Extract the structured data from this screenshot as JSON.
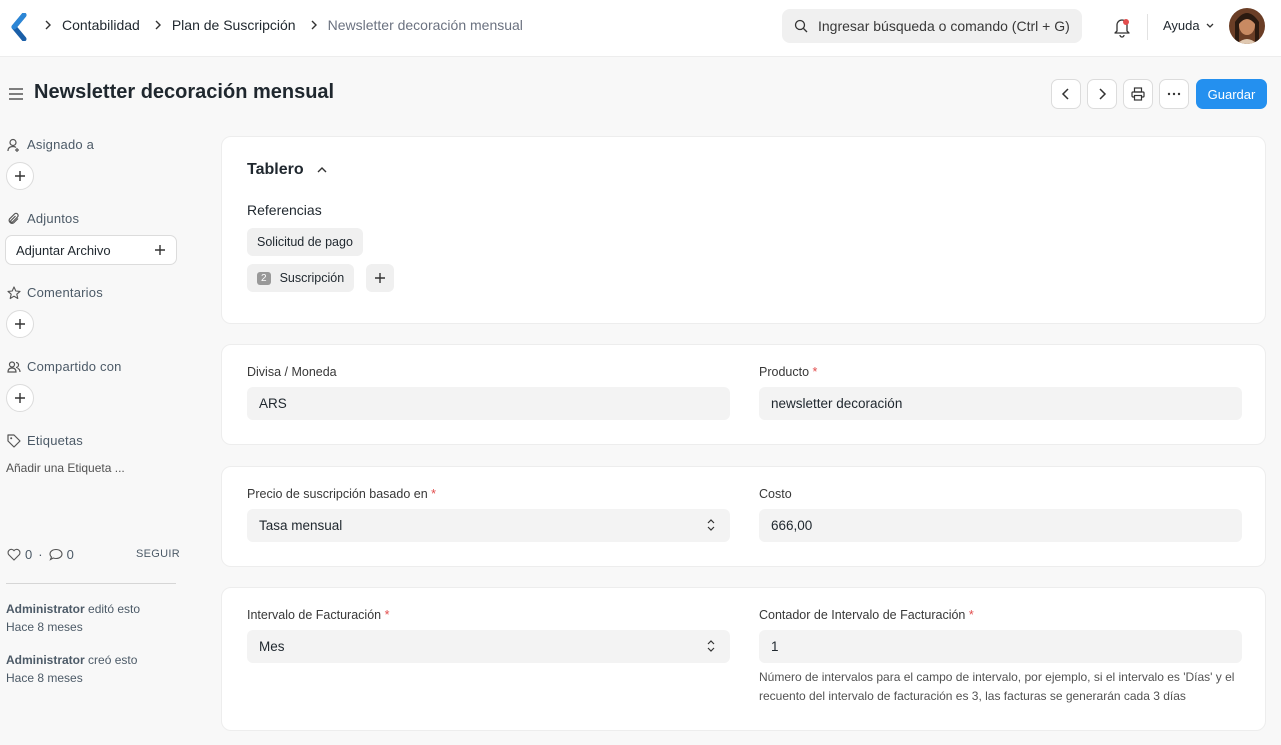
{
  "navbar": {
    "breadcrumbs": [
      "Contabilidad",
      "Plan de Suscripción",
      "Newsletter decoración mensual"
    ],
    "search_placeholder": "Ingresar búsqueda o comando (Ctrl + G)",
    "help_label": "Ayuda",
    "icons": [
      "app-logo-icon",
      "chevron-right-icon",
      "search-icon",
      "bell-icon",
      "chevron-down-icon"
    ]
  },
  "page": {
    "title": "Newsletter decoración mensual",
    "save_label": "Guardar",
    "accent_color": "#2490ef"
  },
  "sidebar": {
    "assigned_label": "Asignado a",
    "attachments_label": "Adjuntos",
    "attach_button": "Adjuntar Archivo",
    "comments_label": "Comentarios",
    "shared_label": "Compartido con",
    "tags_label": "Etiquetas",
    "add_tag": "Añadir una Etiqueta ...",
    "likes_count": "0",
    "comments_count": "0",
    "separator": "·",
    "follow_label": "SEGUIR",
    "activity": [
      {
        "user": "Administrator",
        "action": "editó esto",
        "when": "Hace 8 meses"
      },
      {
        "user": "Administrator",
        "action": "creó esto",
        "when": "Hace 8 meses"
      }
    ]
  },
  "dashboard": {
    "title": "Tablero",
    "references_title": "Referencias",
    "links": [
      {
        "label": "Solicitud de pago",
        "count": ""
      },
      {
        "label": "Suscripción",
        "count": "2"
      }
    ]
  },
  "form": {
    "currency_label": "Divisa / Moneda",
    "currency_value": "ARS",
    "item_label": "Producto",
    "item_value": "newsletter decoración",
    "price_basis_label": "Precio de suscripción basado en",
    "price_basis_value": "Tasa mensual",
    "cost_label": "Costo",
    "cost_value": "666,00",
    "billing_interval_label": "Intervalo de Facturación",
    "billing_interval_value": "Mes",
    "billing_count_label": "Contador de Intervalo de Facturación",
    "billing_count_value": "1",
    "billing_count_help": "Número de intervalos para el campo de intervalo, por ejemplo, si el intervalo es 'Días' y el recuento del intervalo de facturación es 3, las facturas se generarán cada 3 días",
    "required_mark": "*"
  }
}
